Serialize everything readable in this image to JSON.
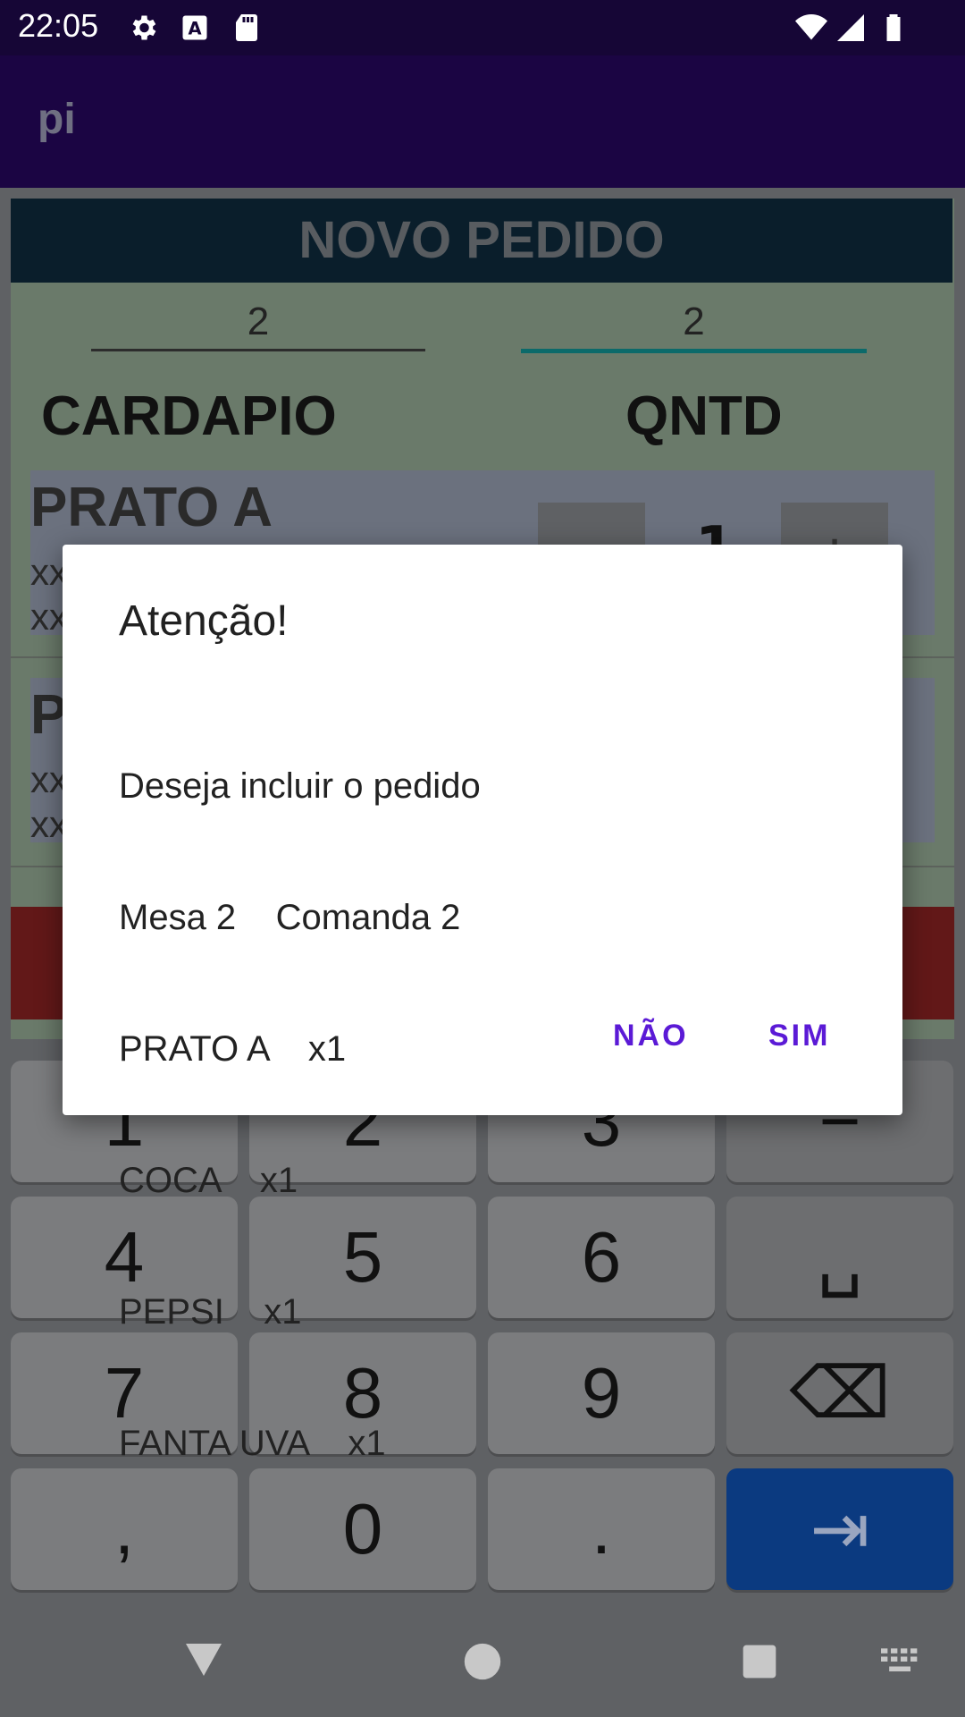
{
  "status_bar": {
    "time": "22:05",
    "icons": [
      "settings-icon",
      "a-notification-icon",
      "sd-card-icon",
      "wifi-icon",
      "signal-icon",
      "battery-icon"
    ]
  },
  "app_bar": {
    "title": "pi"
  },
  "screen": {
    "header": "NOVO PEDIDO",
    "mesa_value": "2",
    "comanda_value": "2",
    "col_cardapio": "CARDAPIO",
    "col_qntd": "QNTD",
    "items": [
      {
        "name": "PRATO A",
        "desc1": "xx",
        "desc2": "xx",
        "qty": "1",
        "minus": "-",
        "plus": "+"
      },
      {
        "name": "P",
        "desc1": "xx",
        "desc2": "xx"
      }
    ]
  },
  "dialog": {
    "title": "Atenção!",
    "lines": [
      "Deseja incluir o pedido",
      "Mesa 2    Comanda 2",
      "PRATO A    x1",
      "COCA    x1",
      "PEPSI    x1",
      "FANTA UVA    x1"
    ],
    "negative": "NÃO",
    "positive": "SIM"
  },
  "keyboard": {
    "row1": [
      "1",
      "2",
      "3",
      "−"
    ],
    "row2": [
      "4",
      "5",
      "6",
      "␣"
    ],
    "row3": [
      "7",
      "8",
      "9",
      "⌫"
    ],
    "row4": [
      ",",
      "0",
      ".",
      "⇥"
    ]
  },
  "nav_bar": {
    "icons": [
      "back-icon",
      "home-icon",
      "recents-icon",
      "keyboard-switch-icon"
    ]
  },
  "colors": {
    "accent": "#5b1ad6",
    "app_bar": "#1b0543",
    "status_bar": "#160636",
    "enter_key": "#0b3a80"
  }
}
